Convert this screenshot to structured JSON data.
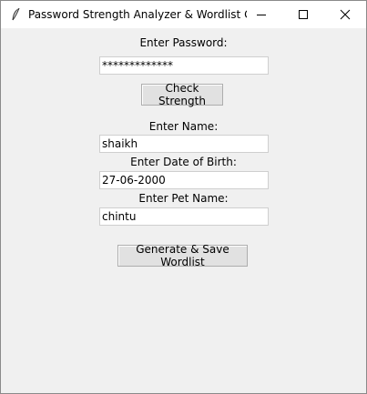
{
  "window": {
    "title": "Password Strength Analyzer & Wordlist Ge..."
  },
  "controls": {
    "minimize": "minimize-icon",
    "maximize": "maximize-icon",
    "close": "close-icon"
  },
  "form": {
    "password_label": "Enter Password:",
    "password_value": "*************",
    "check_button": "Check Strength",
    "name_label": "Enter Name:",
    "name_value": "shaikh",
    "dob_label": "Enter Date of Birth:",
    "dob_value": "27-06-2000",
    "pet_label": "Enter Pet Name:",
    "pet_value": "chintu",
    "generate_button": "Generate & Save Wordlist"
  }
}
